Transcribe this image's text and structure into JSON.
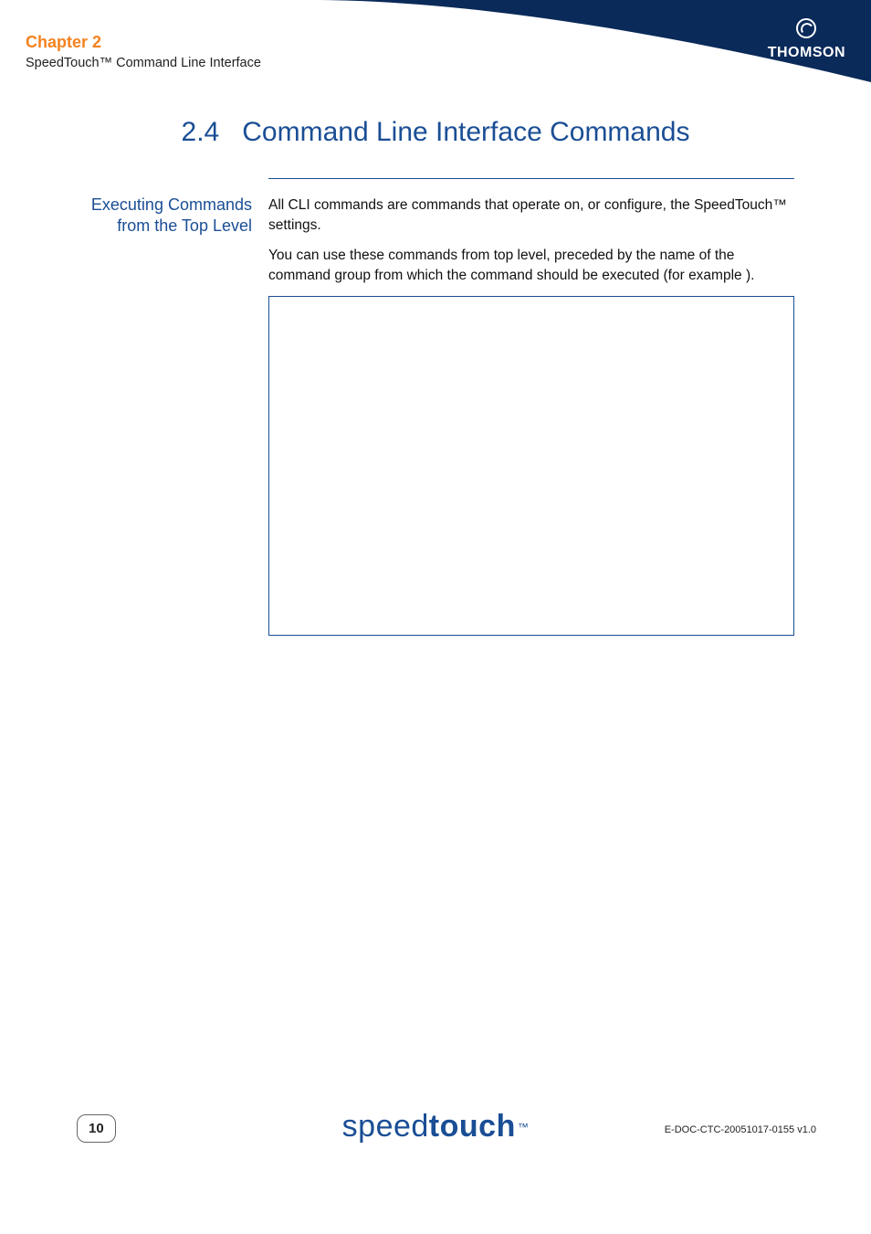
{
  "header": {
    "chapter_label": "Chapter 2",
    "chapter_subtitle": "SpeedTouch™ Command Line Interface",
    "brand": "THOMSON"
  },
  "section": {
    "number": "2.4",
    "title": "Command Line Interface Commands"
  },
  "block": {
    "heading_line1": "Executing Commands",
    "heading_line2": "from the Top Level",
    "para1": "All CLI commands are commands that operate on, or configure, the SpeedTouch™ settings.",
    "para2": "You can use these commands from top level, preceded by the name of the command group from which the command should be executed (for example ",
    "para2_tail": ")."
  },
  "footer": {
    "page_number": "10",
    "logo_thin": "speed",
    "logo_bold": "touch",
    "logo_tm": "™",
    "doc_id": "E-DOC-CTC-20051017-0155 v1.0"
  }
}
